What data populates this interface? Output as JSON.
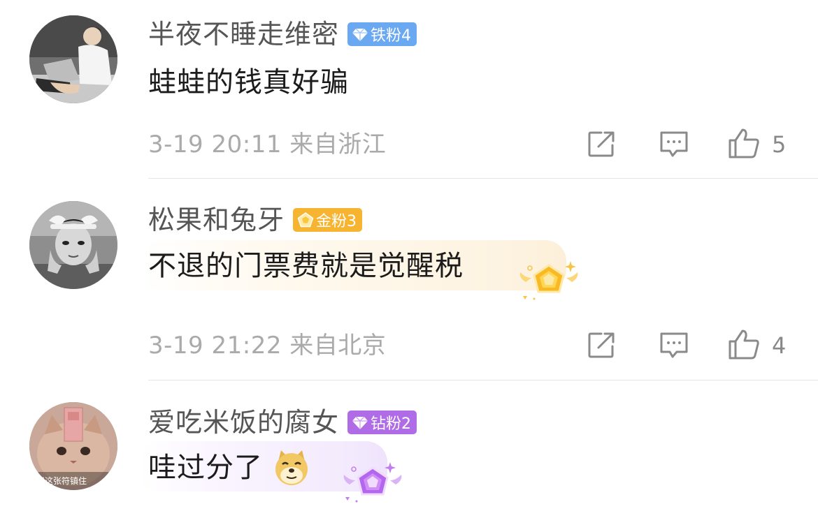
{
  "comments": [
    {
      "username": "半夜不睡走维密",
      "badge": {
        "label": "铁粉4",
        "color": "#6aa8f2",
        "icon": "diamond-icon"
      },
      "text": "蛙蛙的钱真好骗",
      "meta": "3-19 20:11 来自浙江",
      "likes": "5"
    },
    {
      "username": "松果和兔牙",
      "badge": {
        "label": "金粉3",
        "color": "#f6b430",
        "icon": "gold-pentagon-icon"
      },
      "text": "不退的门票费就是觉醒税",
      "meta": "3-19 21:22 来自北京",
      "likes": "4"
    },
    {
      "username": "爱吃米饭的腐女",
      "badge": {
        "label": "钻粉2",
        "color": "#b06ce6",
        "icon": "purple-diamond-icon"
      },
      "text": "哇过分了",
      "avatar_caption": "用这张符镇住"
    }
  ],
  "icons": {
    "share": "share-icon",
    "comment": "comment-icon",
    "like": "thumbs-up-icon",
    "emoji": "doge-emoji-icon"
  }
}
